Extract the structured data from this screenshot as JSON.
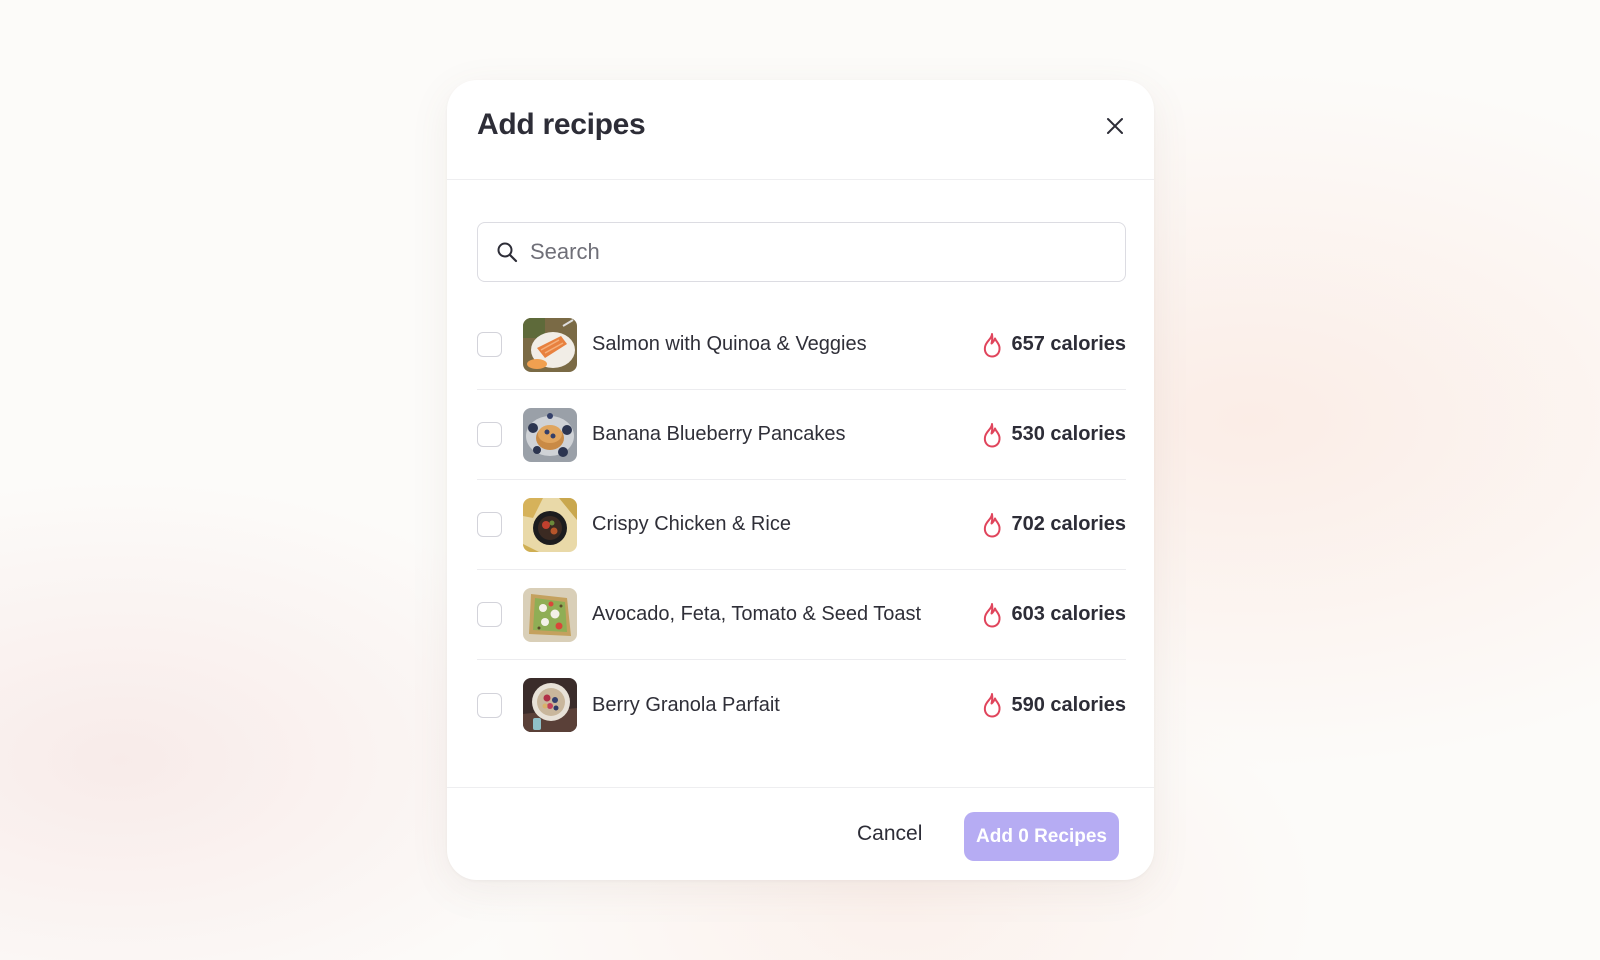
{
  "modal": {
    "title": "Add recipes",
    "close_icon": "close-icon"
  },
  "search": {
    "placeholder": "Search",
    "value": "",
    "icon": "search-icon"
  },
  "recipes": [
    {
      "name": "Salmon with Quinoa & Veggies",
      "calories": "657 calories",
      "checked": false,
      "thumb_icon": "salmon-dish-thumbnail"
    },
    {
      "name": "Banana Blueberry Pancakes",
      "calories": "530 calories",
      "checked": false,
      "thumb_icon": "pancakes-thumbnail"
    },
    {
      "name": "Crispy Chicken & Rice",
      "calories": "702 calories",
      "checked": false,
      "thumb_icon": "chicken-rice-thumbnail"
    },
    {
      "name": "Avocado, Feta, Tomato & Seed Toast",
      "calories": "603 calories",
      "checked": false,
      "thumb_icon": "avocado-toast-thumbnail"
    },
    {
      "name": "Berry Granola Parfait",
      "calories": "590 calories",
      "checked": false,
      "thumb_icon": "parfait-thumbnail"
    }
  ],
  "footer": {
    "cancel_label": "Cancel",
    "add_label": "Add 0 Recipes"
  },
  "colors": {
    "accent": "#b6acf3",
    "flame": "#e0455c",
    "text": "#2d2d37"
  }
}
